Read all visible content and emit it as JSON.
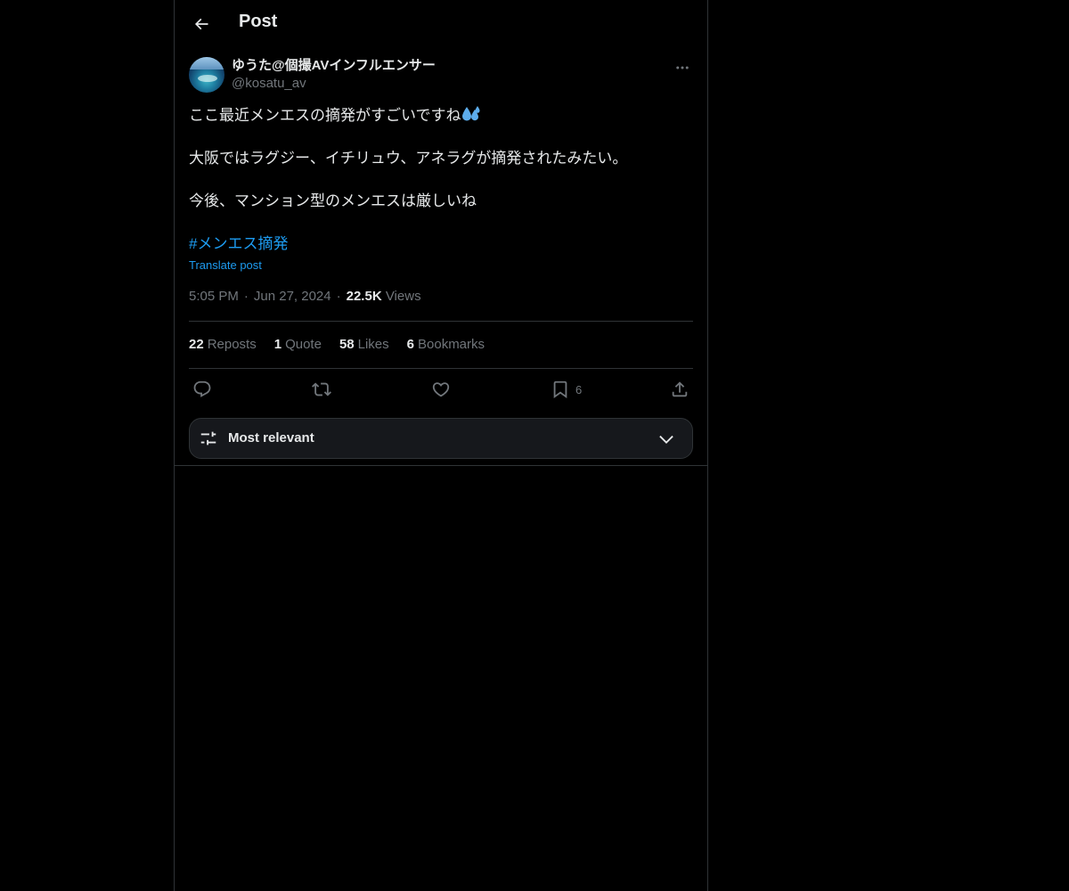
{
  "header": {
    "title": "Post",
    "back_icon": "arrow-left-icon"
  },
  "post": {
    "author": {
      "display_name": "ゆうた@個撮AVインフルエンサー",
      "handle": "@kosatu_av"
    },
    "text_lines": [
      "ここ最近メンエスの摘発がすごいですね",
      "大阪ではラグジー、イチリュウ、アネラグが摘発されたみたい。",
      "今後、マンション型のメンエスは厳しいね"
    ],
    "emoji": "sweat-droplets-emoji",
    "hashtag": "#メンエス摘発",
    "translate_label": "Translate post",
    "time": "5:05 PM",
    "date": "Jun 27, 2024",
    "views_count": "22.5K",
    "views_label": "Views",
    "separator": "·"
  },
  "stats": {
    "reposts": {
      "count": "22",
      "label": "Reposts"
    },
    "quotes": {
      "count": "1",
      "label": "Quote"
    },
    "likes": {
      "count": "58",
      "label": "Likes"
    },
    "bookmarks": {
      "count": "6",
      "label": "Bookmarks"
    }
  },
  "actions": {
    "bookmark_count": "6"
  },
  "sort": {
    "label": "Most relevant"
  },
  "colors": {
    "background": "#000000",
    "text": "#e7e9ea",
    "secondary": "#71767b",
    "accent": "#1d9bf0",
    "border": "#2f3336"
  }
}
